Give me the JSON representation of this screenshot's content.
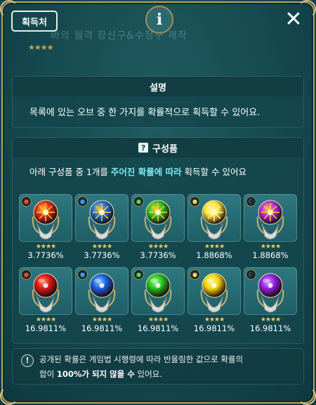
{
  "header": {
    "source_button": "획득처",
    "info_icon": "i",
    "close_icon": "✕",
    "bg_title": "바의 월격 장신구&수정구 제작"
  },
  "description": {
    "title": "설명",
    "text": "목록에 있는 오브 중 한 가지를 확률적으로 획득할 수 있어요."
  },
  "components": {
    "title": "구성품",
    "help_icon": "?",
    "line_pre": "아래 구성품 중 1개를 ",
    "line_hl": "주어진 확률에 따라",
    "line_post": " 획득할 수 있어요"
  },
  "stars": "★★★★",
  "items": [
    {
      "element": "fire",
      "color": "#e0281c",
      "glow": "#ffcc33",
      "fancy": true,
      "prob": "3.7736%"
    },
    {
      "element": "water",
      "color": "#1d6fe0",
      "glow": "#ffcc33",
      "fancy": true,
      "prob": "3.7736%"
    },
    {
      "element": "wind",
      "color": "#2cc42a",
      "glow": "#ffcc33",
      "fancy": true,
      "prob": "3.7736%"
    },
    {
      "element": "light",
      "color": "#ffe23a",
      "glow": "#fff6a0",
      "fancy": true,
      "prob": "1.8868%"
    },
    {
      "element": "dark",
      "color": "#b42ee0",
      "glow": "#ffcc33",
      "fancy": true,
      "prob": "1.8868%"
    },
    {
      "element": "fire",
      "color": "#d81818",
      "glow": "#ff8a6a",
      "fancy": false,
      "prob": "16.9811%"
    },
    {
      "element": "water",
      "color": "#1a5fe0",
      "glow": "#8ac4ff",
      "fancy": false,
      "prob": "16.9811%"
    },
    {
      "element": "wind",
      "color": "#22c21e",
      "glow": "#aef59a",
      "fancy": false,
      "prob": "16.9811%"
    },
    {
      "element": "light",
      "color": "#f5d514",
      "glow": "#fff4a0",
      "fancy": false,
      "prob": "16.9811%"
    },
    {
      "element": "dark",
      "color": "#8f1fe0",
      "glow": "#d7a0ff",
      "fancy": false,
      "prob": "16.9811%"
    }
  ],
  "notice": {
    "icon": "!",
    "line1": "공개된 확률은 게임법 시행령에 따라 반올림한 값으로 확률의",
    "line2_pre": "합이 ",
    "line2_bold": "100%가 되지 않을 수",
    "line2_post": " 있어요."
  }
}
